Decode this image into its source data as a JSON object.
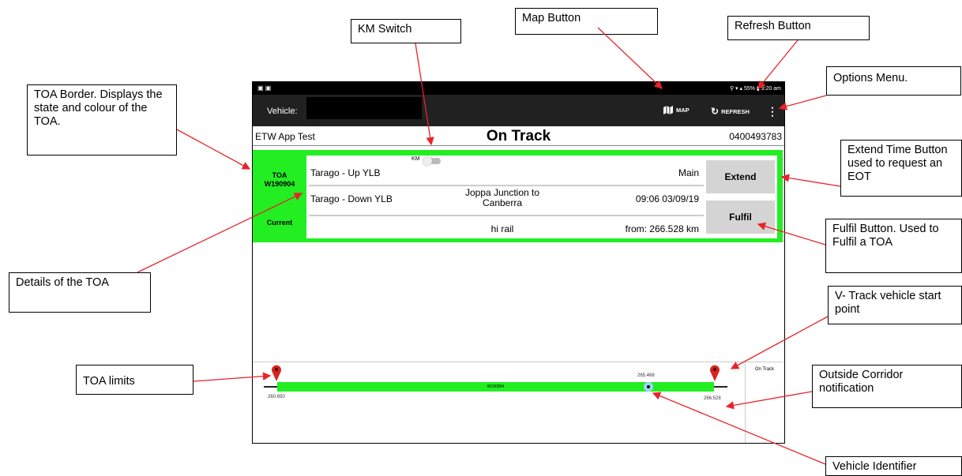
{
  "callouts": {
    "km_switch": "KM Switch",
    "map_button": "Map Button",
    "refresh_button": "Refresh Button",
    "options_menu": "Options Menu.",
    "toa_border": "TOA Border. Displays the state and colour of the TOA.",
    "extend_time": "Extend Time Button used to request an EOT",
    "fulfil": "Fulfil Button. Used to Fulfil a TOA",
    "details": "Details of the TOA",
    "vtrack_start": "V- Track vehicle start point",
    "toa_limits": "TOA limits",
    "outside_corridor": "Outside Corridor notification",
    "vehicle_identifier": "Vehicle Identifier"
  },
  "statusbar": {
    "time": "9:20 am",
    "battery": "55%"
  },
  "appbar": {
    "vehicle_label": "Vehicle: ",
    "map_label": "MAP",
    "refresh_label": "REFRESH"
  },
  "info": {
    "app_name": "ETW App Test",
    "state": "On Track",
    "phone": "0400493783"
  },
  "toa": {
    "badge": "TOA",
    "id": "W190904",
    "status": "Current",
    "km_toggle_label": "KM",
    "row1": {
      "location": "Tarago - Up YLB",
      "middle": "",
      "right": "Main"
    },
    "row2": {
      "location": "Tarago - Down YLB",
      "middle": "Joppa Junction to Canberra",
      "right": "09:06 03/09/19"
    },
    "row3": {
      "location": "",
      "middle": "hi rail",
      "right": "from: 266.528 km"
    },
    "extend_label": "Extend",
    "fulfil_label": "Fulfil"
  },
  "track": {
    "bar_label": "W190904",
    "start_km": "260.650",
    "end_km": "266.528",
    "vehicle_km": "265.468",
    "ontrack_label": "On Track"
  },
  "colors": {
    "toa_green": "#22ee22",
    "arrow_red": "#e8232a",
    "appbar": "#212121"
  }
}
